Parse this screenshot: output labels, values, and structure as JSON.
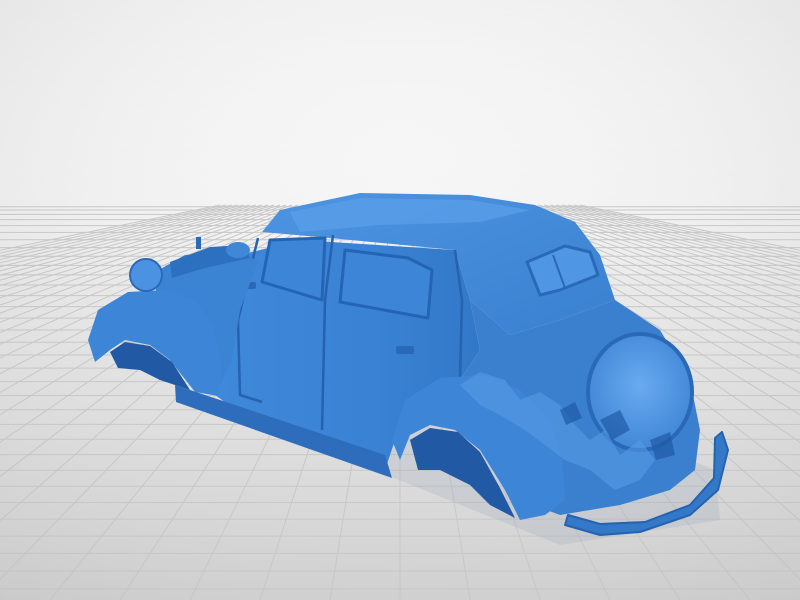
{
  "scene": {
    "subject": "car-body-3d-render",
    "colors": {
      "background_top": "#ffffff",
      "background_mid": "#eeeeee",
      "floor": "#d9d9d9",
      "grid_line": "#c3c3c3",
      "model_base": "#3a84d6",
      "model_light": "#5da2ea",
      "model_dark": "#2464b4",
      "model_shadow": "#1f5aa6"
    }
  }
}
